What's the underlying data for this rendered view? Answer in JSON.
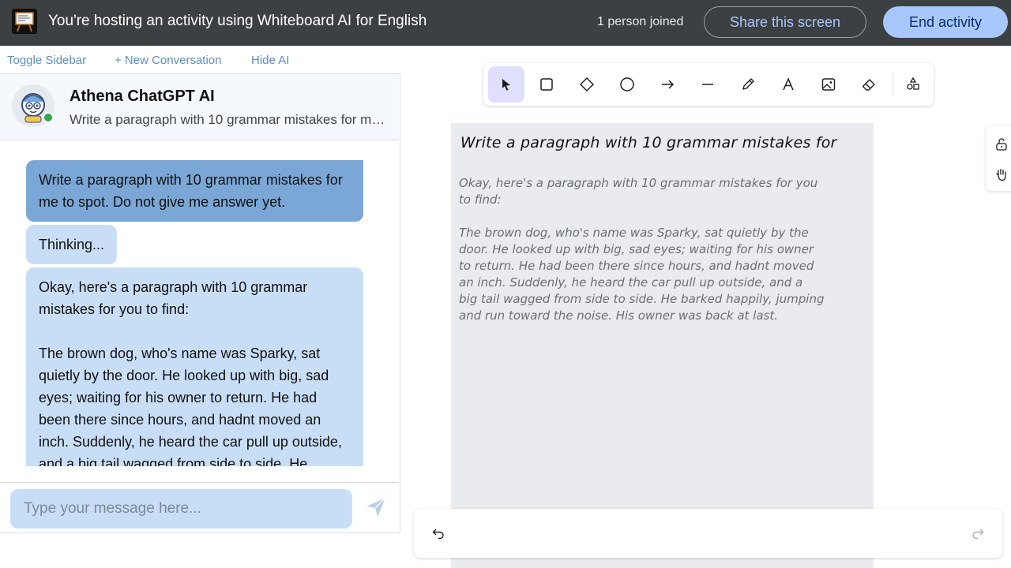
{
  "topbar": {
    "hosting_text": "You're hosting an activity using Whiteboard AI for English",
    "joined_text": "1 person joined",
    "share_label": "Share this screen",
    "end_label": "End activity"
  },
  "links": {
    "toggle_sidebar": "Toggle Sidebar",
    "new_conversation": "+ New Conversation",
    "hide_ai": "Hide AI"
  },
  "chat": {
    "bot_name": "Athena ChatGPT AI",
    "preview": "Write a paragraph with 10 grammar mistakes for me to spot. Do not give me answer yet.",
    "messages": {
      "user": "Write a paragraph with 10 grammar mistakes for me to spot. Do not give me answer yet.",
      "thinking": "Thinking...",
      "reply": "Okay, here's a paragraph with 10 grammar mistakes for you to find:\n\nThe brown dog, who's name was Sparky, sat quietly by the door. He looked up with big, sad eyes; waiting for his owner to return. He had been there since hours, and hadnt moved an inch. Suddenly, he heard the car pull up outside, and a big tail wagged from side to side. He barked happily, jumping and run toward the noise. His owner was back at last."
    },
    "input_placeholder": "Type your message here..."
  },
  "whiteboard": {
    "title": "Write a paragraph with 10 grammar mistakes for",
    "body": "Okay, here's a paragraph with 10 grammar mistakes for you\nto find:\n\nThe brown dog, who's name was Sparky, sat quietly by the\ndoor. He looked up with big, sad eyes; waiting for his owner\nto return. He had been there since hours, and hadnt moved\nan inch. Suddenly, he heard the car pull up outside, and a\nbig tail wagged from side to side. He barked happily, jumping\nand run toward the noise. His owner was back at last.",
    "tools": [
      "select",
      "rectangle",
      "diamond",
      "ellipse",
      "arrow",
      "line",
      "pencil",
      "text",
      "image",
      "eraser",
      "more-shapes"
    ],
    "active_tool": "select"
  },
  "colors": {
    "topbar_bg": "#3c4043",
    "accent": "#a8c7fa",
    "user_bubble": "#7ba7d6",
    "bot_bubble": "#c8def7",
    "online": "#34a853"
  }
}
